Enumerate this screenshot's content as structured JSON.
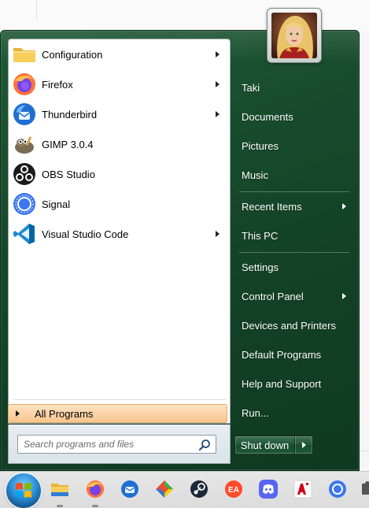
{
  "programs": [
    {
      "label": "Configuration",
      "icon": "folder-icon",
      "has_submenu": true
    },
    {
      "label": "Firefox",
      "icon": "firefox-icon",
      "has_submenu": true
    },
    {
      "label": "Thunderbird",
      "icon": "thunderbird-icon",
      "has_submenu": true
    },
    {
      "label": "GIMP 3.0.4",
      "icon": "gimp-icon",
      "has_submenu": false
    },
    {
      "label": "OBS Studio",
      "icon": "obs-icon",
      "has_submenu": false
    },
    {
      "label": "Signal",
      "icon": "signal-icon",
      "has_submenu": false
    },
    {
      "label": "Visual Studio Code",
      "icon": "vscode-icon",
      "has_submenu": true
    }
  ],
  "all_programs_label": "All Programs",
  "search": {
    "placeholder": "Search programs and files",
    "value": ""
  },
  "right_items": [
    {
      "label": "Taki",
      "has_submenu": false
    },
    {
      "label": "Documents",
      "has_submenu": false
    },
    {
      "label": "Pictures",
      "has_submenu": false
    },
    {
      "label": "Music",
      "has_submenu": false
    },
    {
      "label": "Recent Items",
      "has_submenu": true
    },
    {
      "label": "This PC",
      "has_submenu": false
    },
    {
      "label": "Settings",
      "has_submenu": false
    },
    {
      "label": "Control Panel",
      "has_submenu": true
    },
    {
      "label": "Devices and Printers",
      "has_submenu": false
    },
    {
      "label": "Default Programs",
      "has_submenu": false
    },
    {
      "label": "Help and Support",
      "has_submenu": false
    },
    {
      "label": "Run...",
      "has_submenu": false
    }
  ],
  "shutdown_label": "Shut down",
  "taskbar_icons": [
    "start-orb-icon",
    "file-explorer-icon",
    "firefox-icon",
    "thunderbird-icon",
    "git-icon",
    "steam-icon",
    "ea-icon",
    "discord-icon",
    "amd-icon",
    "signal-icon",
    "puzzle-icon"
  ],
  "colors": {
    "menu_green": "#174a2c",
    "all_programs_bg": "#f9c58e",
    "panel_white": "#ffffff"
  }
}
